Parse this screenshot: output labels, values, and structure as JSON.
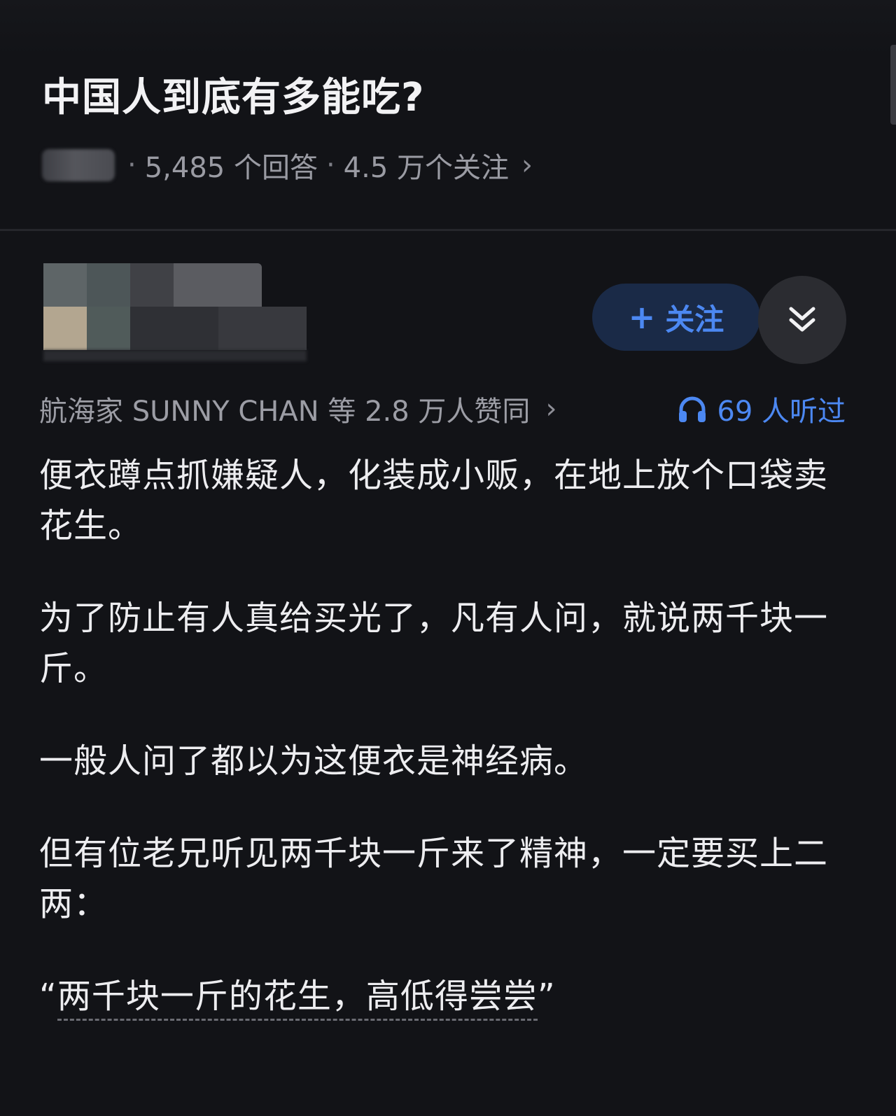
{
  "question": {
    "title": "中国人到底有多能吃?",
    "answers_count": "5,485 个回答",
    "followers_count": "4.5 万个关注",
    "separator": "·",
    "chevron": "›"
  },
  "author": {
    "follow_button": {
      "icon": "plus-icon",
      "plus": "+",
      "label": "关注"
    },
    "collapse_icon": "double-chevron-down-icon"
  },
  "stats": {
    "upvote_text": "航海家 SUNNY CHAN 等 2.8 万人赞同",
    "chevron": "›",
    "listen_icon": "headphones-icon",
    "listen_text": "69 人听过"
  },
  "answer": {
    "paragraphs": [
      "便衣蹲点抓嫌疑人，化装成小贩，在地上放个口袋卖花生。",
      "为了防止有人真给买光了，凡有人问，就说两千块一斤。",
      "一般人问了都以为这便衣是神经病。",
      "但有位老兄听见两千块一斤来了精神，一定要买上二两："
    ],
    "quote": {
      "open": "“",
      "text": "两千块一斤的花生，高低得尝尝",
      "close": "”"
    }
  },
  "colors": {
    "background": "#121317",
    "accent": "#4C88F2",
    "follow_bg": "#1A2A47",
    "text": "#EDEDF0",
    "muted": "#9A9BA3"
  }
}
